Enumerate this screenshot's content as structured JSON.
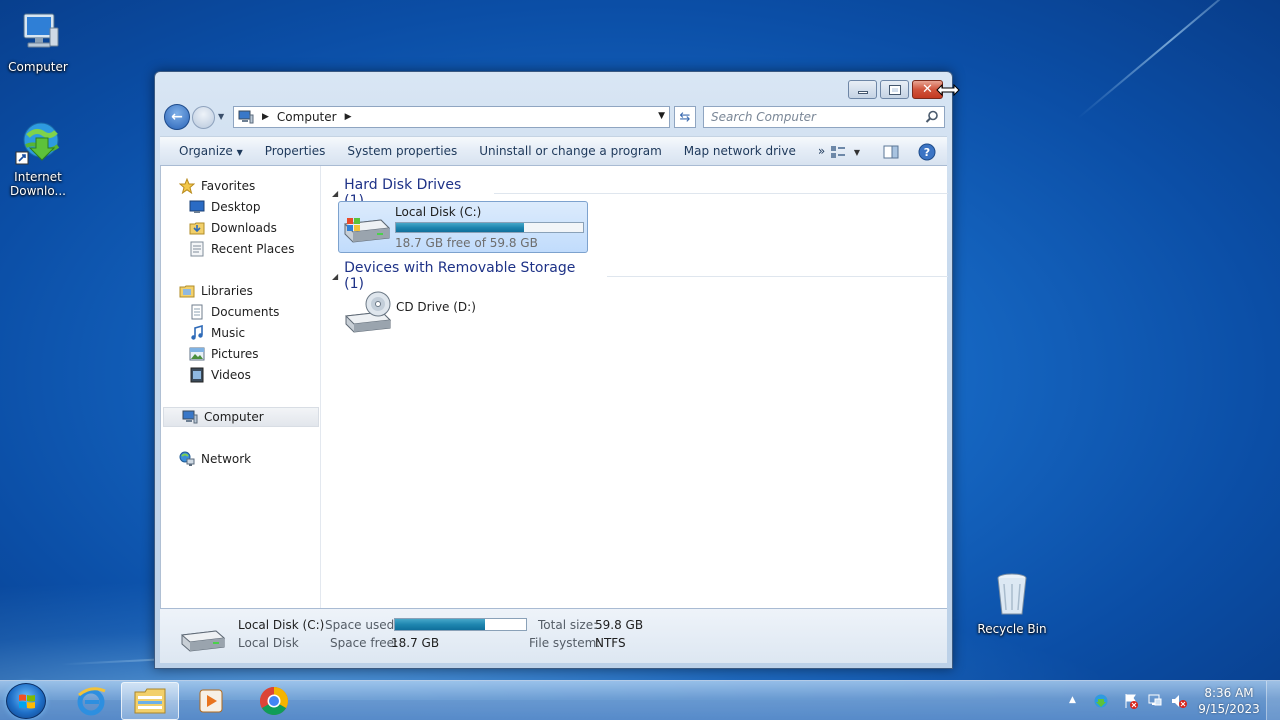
{
  "desktop": {
    "icons": [
      {
        "label": "Computer"
      },
      {
        "label": "Internet Downlo..."
      },
      {
        "label": "Recycle Bin"
      }
    ]
  },
  "window": {
    "address": {
      "segment": "Computer"
    },
    "search": {
      "placeholder": "Search Computer"
    },
    "toolbar": {
      "organize": "Organize",
      "properties": "Properties",
      "system_properties": "System properties",
      "uninstall": "Uninstall or change a program",
      "map_network": "Map network drive",
      "more": "»"
    },
    "nav_pane": {
      "favorites": "Favorites",
      "desktop": "Desktop",
      "downloads": "Downloads",
      "recent_places": "Recent Places",
      "libraries": "Libraries",
      "documents": "Documents",
      "music": "Music",
      "pictures": "Pictures",
      "videos": "Videos",
      "computer": "Computer",
      "network": "Network"
    },
    "groups": {
      "hard_disk": "Hard Disk Drives (1)",
      "removable": "Devices with Removable Storage (1)"
    },
    "drives": {
      "c": {
        "name": "Local Disk (C:)",
        "free_text": "18.7 GB free of 59.8 GB",
        "used_fraction": 0.687
      },
      "d": {
        "name": "CD Drive (D:)"
      }
    },
    "details": {
      "name": "Local Disk (C:)",
      "type": "Local Disk",
      "space_used_label": "Space used:",
      "space_free_label": "Space free:",
      "space_free": "18.7 GB",
      "total_size_label": "Total size:",
      "total_size": "59.8 GB",
      "file_system_label": "File system:",
      "file_system": "NTFS"
    }
  },
  "taskbar": {
    "clock_time": "8:36 AM",
    "clock_date": "9/15/2023"
  },
  "colors": {
    "accent": "#1e3287",
    "progress": "#1f86b0",
    "selection": "#c1dcfc"
  }
}
